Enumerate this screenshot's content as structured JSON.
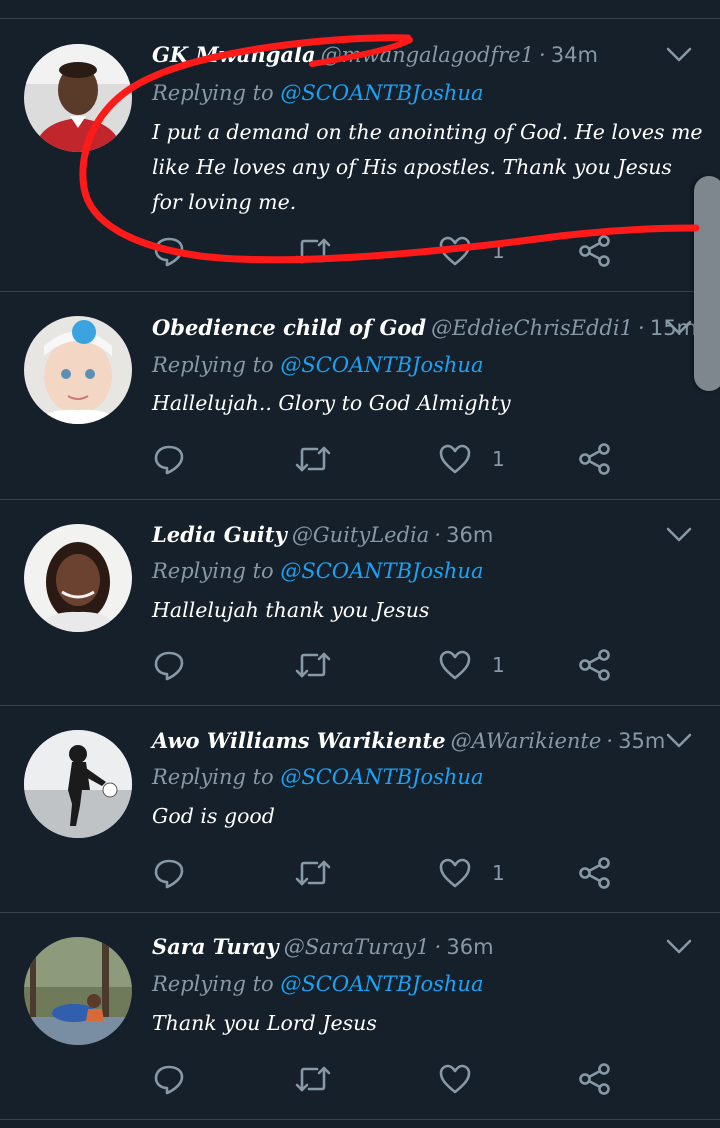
{
  "tweets": [
    {
      "name": "GK Mwangala",
      "handle": "@mwangalagodfre1",
      "time": "34m",
      "reply_prefix": "Replying to",
      "reply_mention": "@SCOANTBJoshua",
      "body": "I put a demand on the anointing of God. He loves me like He loves any of His apostles. Thank you Jesus for loving me.",
      "like_count": "1"
    },
    {
      "name": "Obedience child of God",
      "handle": "@EddieChrisEddi1",
      "time": "15m",
      "reply_prefix": "Replying to",
      "reply_mention": "@SCOANTBJoshua",
      "body": "Hallelujah.. Glory to God Almighty",
      "like_count": "1"
    },
    {
      "name": "Ledia Guity",
      "handle": "@GuityLedia",
      "time": "36m",
      "reply_prefix": "Replying to",
      "reply_mention": "@SCOANTBJoshua",
      "body": "Hallelujah thank you Jesus",
      "like_count": "1"
    },
    {
      "name": "Awo Williams Warikiente",
      "handle": "@AWarikiente",
      "time": "35m",
      "reply_prefix": "Replying to",
      "reply_mention": "@SCOANTBJoshua",
      "body": "God is good",
      "like_count": "1"
    },
    {
      "name": "Sara Turay",
      "handle": "@SaraTuray1",
      "time": "36m",
      "reply_prefix": "Replying to",
      "reply_mention": "@SCOANTBJoshua",
      "body": "Thank you Lord Jesus",
      "like_count": ""
    }
  ],
  "separator": "·",
  "icons": {
    "reply": "reply-icon",
    "retweet": "retweet-icon",
    "like": "heart-icon",
    "share": "share-icon",
    "menu": "chevron-down-icon"
  },
  "colors": {
    "background": "#15202b",
    "divider": "#38444d",
    "secondary_text": "#8899a6",
    "accent": "#1da1f2",
    "annotation": "#ff1a1a"
  }
}
